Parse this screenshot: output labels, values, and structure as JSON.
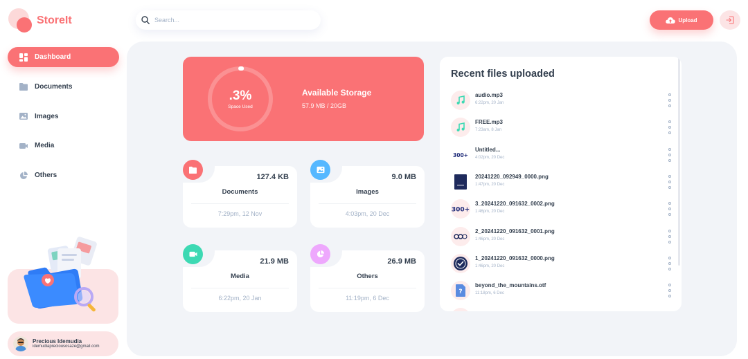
{
  "app": {
    "name": "StoreIt"
  },
  "colors": {
    "brand": "#FA7275",
    "documents": "#FA7275",
    "images": "#56B8FF",
    "media": "#3DD9B3",
    "others": "#EEA8FD"
  },
  "sidebar": {
    "items": [
      {
        "label": "Dashboard",
        "icon": "dashboard-icon",
        "active": true
      },
      {
        "label": "Documents",
        "icon": "documents-icon",
        "active": false
      },
      {
        "label": "Images",
        "icon": "images-icon",
        "active": false
      },
      {
        "label": "Media",
        "icon": "media-icon",
        "active": false
      },
      {
        "label": "Others",
        "icon": "others-icon",
        "active": false
      }
    ]
  },
  "user": {
    "name": "Precious Idemudia",
    "email": "idemudiapreciousosaze@gmail.com"
  },
  "search": {
    "placeholder": "Search..."
  },
  "header": {
    "upload_label": "Upload"
  },
  "storage": {
    "percent_label": ".3%",
    "percent_value": 0.3,
    "used_label": "Space Used",
    "title": "Available Storage",
    "value": "57.9 MB / 20GB"
  },
  "categories": [
    {
      "name": "Documents",
      "size": "127.4 KB",
      "date": "7:29pm, 12 Nov",
      "icon": "documents-icon"
    },
    {
      "name": "Images",
      "size": "9.0 MB",
      "date": "4:03pm, 20 Dec",
      "icon": "images-icon"
    },
    {
      "name": "Media",
      "size": "21.9 MB",
      "date": "6:22pm, 20 Jan",
      "icon": "media-icon"
    },
    {
      "name": "Others",
      "size": "26.9 MB",
      "date": "11:19pm, 6 Dec",
      "icon": "others-icon"
    }
  ],
  "recent": {
    "title": "Recent files uploaded",
    "files": [
      {
        "name": "audio.mp3",
        "date": "6:22pm, 20 Jan",
        "icon": "music-icon"
      },
      {
        "name": "FREE.mp3",
        "date": "7:23am, 8 Jan",
        "icon": "music-icon"
      },
      {
        "name": "Untitled...",
        "date": "4:02pm, 20 Dec",
        "icon": "image-thumbnail-icon"
      },
      {
        "name": "20241220_092949_0000.png",
        "date": "1:47pm, 20 Dec",
        "icon": "image-thumbnail-icon"
      },
      {
        "name": "3_20241220_091632_0002.png",
        "date": "1:46pm, 20 Dec",
        "icon": "image-thumbnail-icon"
      },
      {
        "name": "2_20241220_091632_0001.png",
        "date": "1:46pm, 20 Dec",
        "icon": "image-thumbnail-icon"
      },
      {
        "name": "1_20241220_091632_0000.png",
        "date": "1:46pm, 20 Dec",
        "icon": "image-thumbnail-icon"
      },
      {
        "name": "beyond_the_mountains.otf",
        "date": "11:18pm, 6 Dec",
        "icon": "unknown-file-icon"
      }
    ]
  }
}
